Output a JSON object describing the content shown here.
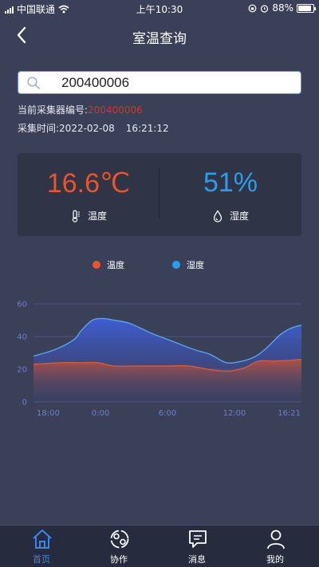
{
  "status_bar": {
    "carrier": "中国联通",
    "time": "上午10:30",
    "battery": "88%"
  },
  "header": {
    "title": "室温查询"
  },
  "search": {
    "value": "200400006"
  },
  "info": {
    "collector_label": "当前采集器编号:",
    "collector_value": "200400006",
    "time_label": "采集时间:",
    "date": "2022-02-08",
    "time": "16:21:12"
  },
  "reading": {
    "temperature": "16.6℃",
    "temperature_label": "温度",
    "humidity": "51%",
    "humidity_label": "湿度"
  },
  "colors": {
    "temperature": "#e8542b",
    "humidity": "#2b9cee",
    "active_tab": "#3a87e8"
  },
  "chart_data": {
    "type": "area",
    "categories": [
      "18:00",
      "0:00",
      "6:00",
      "12:00",
      "16:21"
    ],
    "ylim": [
      0,
      60
    ],
    "y_ticks": [
      0,
      20,
      40,
      60
    ],
    "grid": true,
    "legend_position": "top",
    "series": [
      {
        "name": "温度",
        "color": "#e8542b",
        "x": [
          0,
          0.1,
          0.17,
          0.24,
          0.3,
          0.4,
          0.5,
          0.58,
          0.65,
          0.7,
          0.74,
          0.79,
          0.84,
          0.9,
          1.0
        ],
        "values": [
          23,
          24,
          24,
          24,
          22,
          22,
          22,
          22,
          20,
          19,
          19,
          21,
          25,
          25,
          26
        ]
      },
      {
        "name": "湿度",
        "color": "#2b9cee",
        "x": [
          0,
          0.08,
          0.15,
          0.18,
          0.22,
          0.26,
          0.3,
          0.36,
          0.44,
          0.52,
          0.6,
          0.66,
          0.72,
          0.78,
          0.83,
          0.87,
          0.92,
          0.96,
          1.0
        ],
        "values": [
          28,
          32,
          38,
          44,
          50,
          51,
          50,
          48,
          42,
          37,
          32,
          29,
          24,
          25,
          28,
          33,
          41,
          45,
          47
        ]
      }
    ]
  },
  "tabs": [
    {
      "label": "首页",
      "icon": "home-icon",
      "active": true
    },
    {
      "label": "协作",
      "icon": "collaborate-icon",
      "active": false
    },
    {
      "label": "消息",
      "icon": "message-icon",
      "active": false
    },
    {
      "label": "我的",
      "icon": "profile-icon",
      "active": false
    }
  ]
}
